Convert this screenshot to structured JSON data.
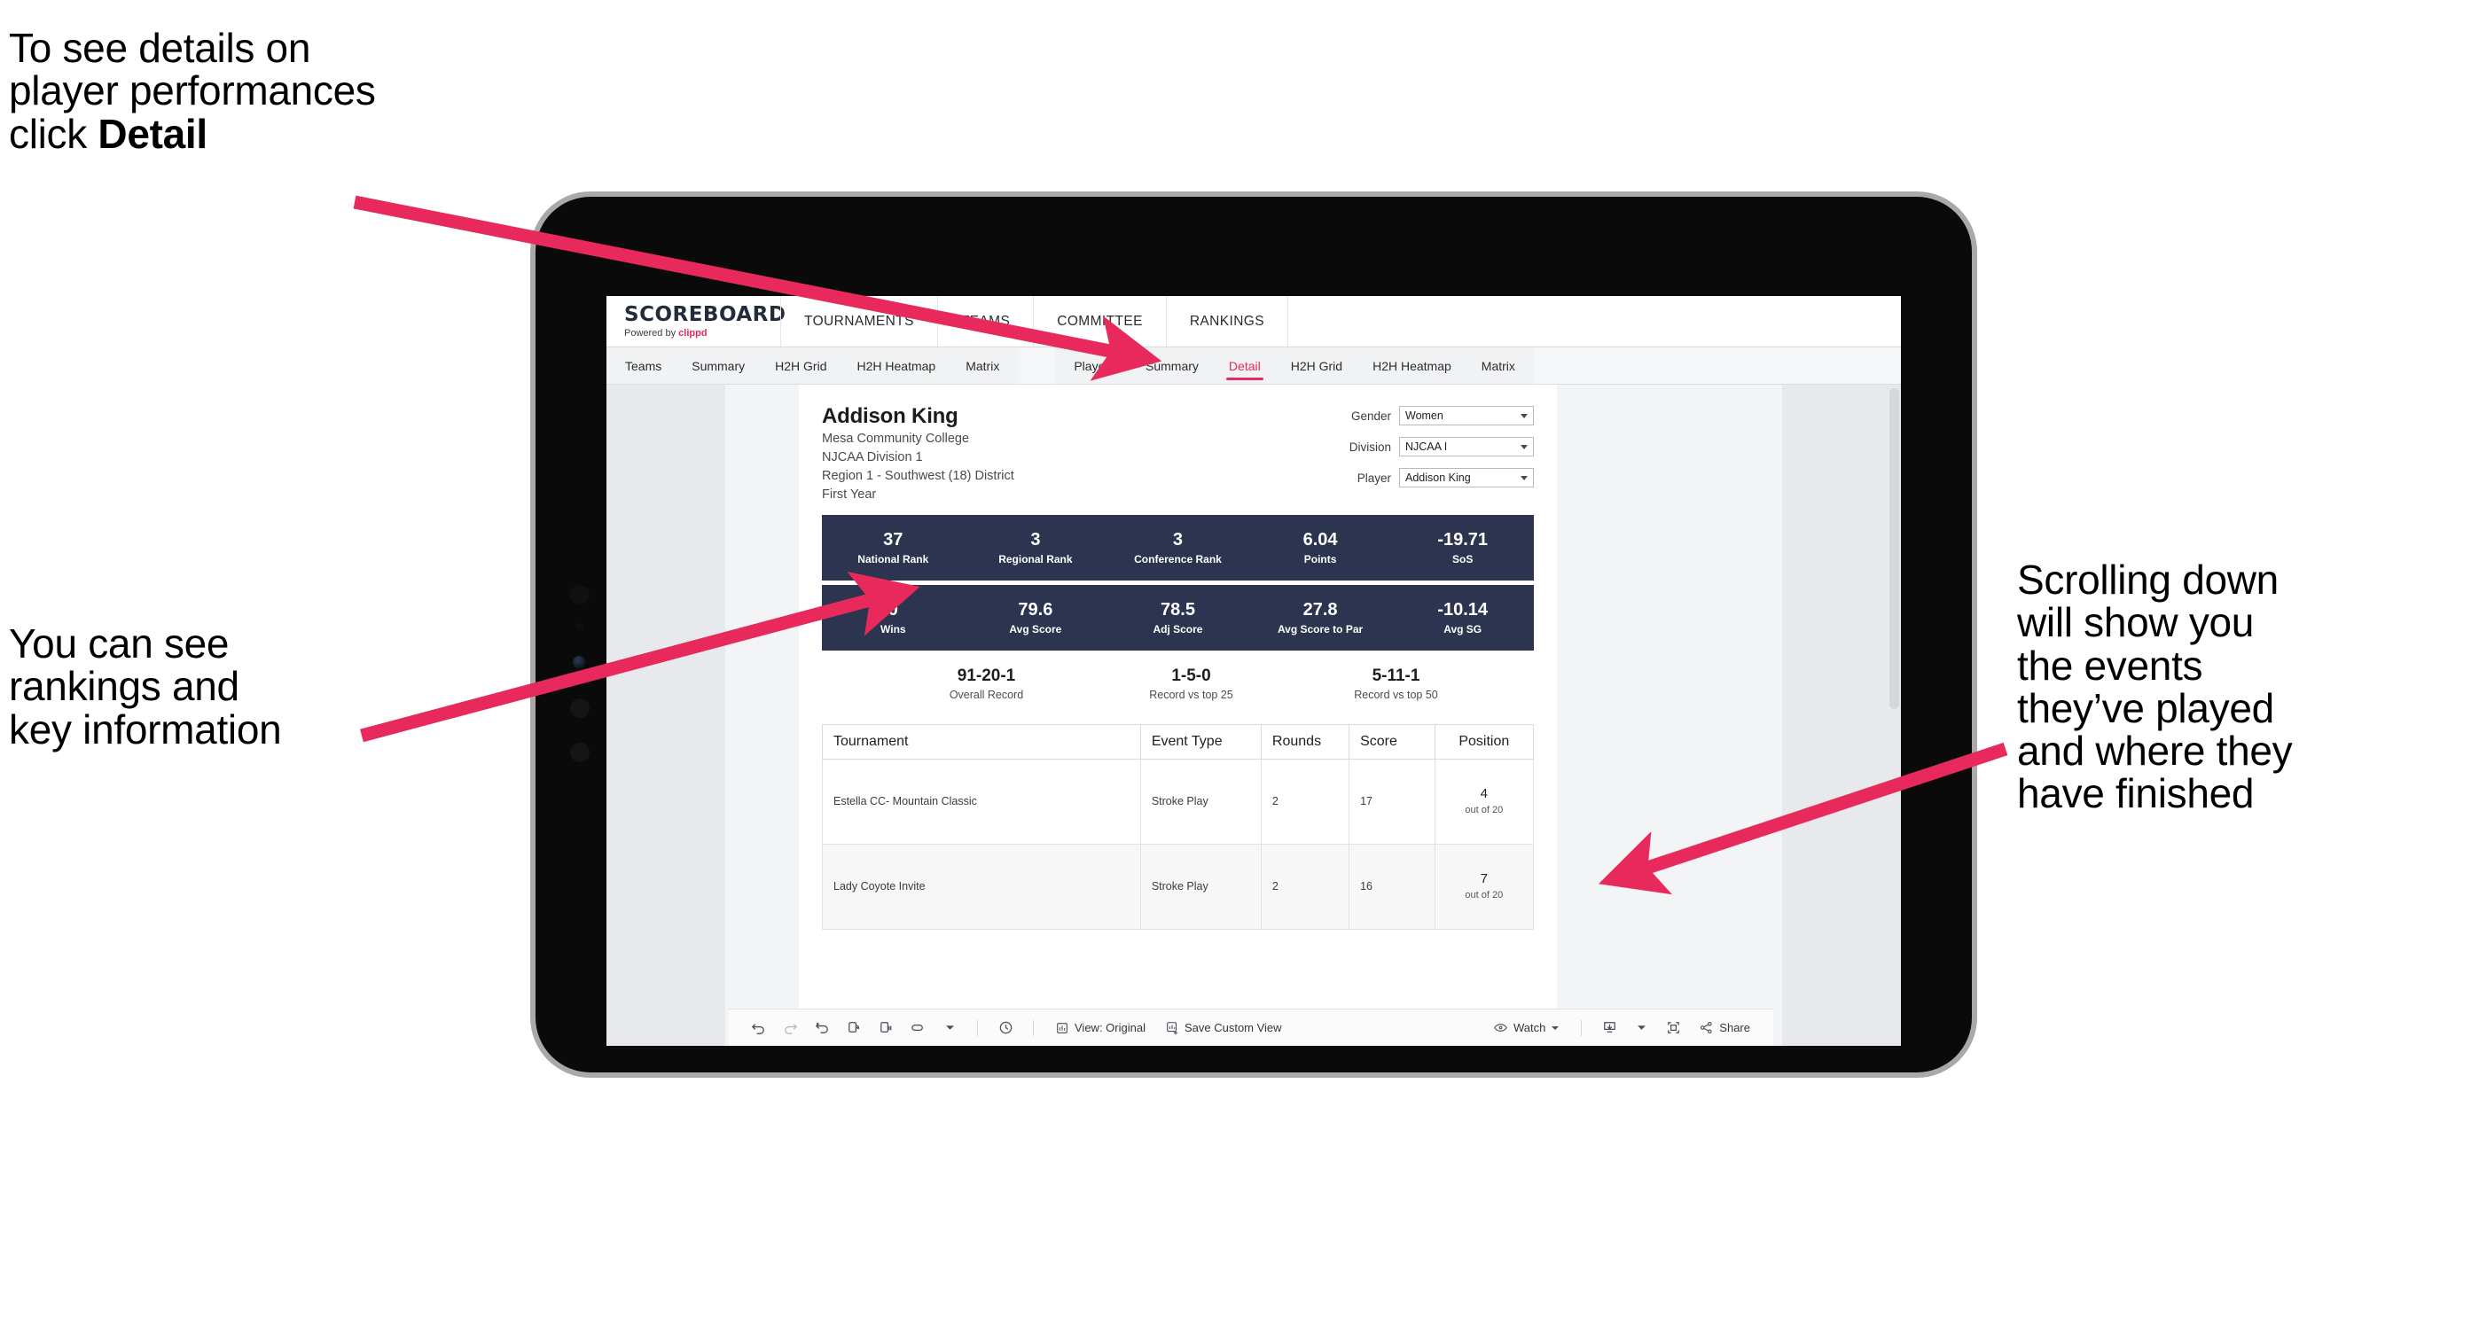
{
  "annotations": {
    "top_left": {
      "line1": "To see details on",
      "line2": "player performances",
      "line3_pre": "click ",
      "line3_bold": "Detail"
    },
    "mid_left": {
      "line1": "You can see",
      "line2": "rankings and",
      "line3": "key information"
    },
    "right": {
      "line1": "Scrolling down",
      "line2": "will show you",
      "line3": "the events",
      "line4": "they’ve played",
      "line5": "and where they",
      "line6": "have finished"
    },
    "arrow_color": "#e8295c"
  },
  "app": {
    "logo": {
      "title": "SCOREBOARD",
      "powered_prefix": "Powered by ",
      "brand": "clippd"
    },
    "top_nav": [
      "TOURNAMENTS",
      "TEAMS",
      "COMMITTEE",
      "RANKINGS"
    ],
    "sub_nav_left": [
      "Teams",
      "Summary",
      "H2H Grid",
      "H2H Heatmap",
      "Matrix"
    ],
    "sub_nav_right": [
      "Players",
      "Summary",
      "Detail",
      "H2H Grid",
      "H2H Heatmap",
      "Matrix"
    ],
    "active_sub_tab": "Detail"
  },
  "player": {
    "name": "Addison King",
    "school": "Mesa Community College",
    "division": "NJCAA Division 1",
    "region": "Region 1 - Southwest (18) District",
    "class_year": "First Year"
  },
  "filters": [
    {
      "label": "Gender",
      "value": "Women"
    },
    {
      "label": "Division",
      "value": "NJCAA I"
    },
    {
      "label": "Player",
      "value": "Addison King"
    }
  ],
  "stats_row_1": [
    {
      "value": "37",
      "label": "National Rank"
    },
    {
      "value": "3",
      "label": "Regional Rank"
    },
    {
      "value": "3",
      "label": "Conference Rank"
    },
    {
      "value": "6.04",
      "label": "Points"
    },
    {
      "value": "-19.71",
      "label": "SoS"
    }
  ],
  "stats_row_2": [
    {
      "value": "0",
      "label": "Wins"
    },
    {
      "value": "79.6",
      "label": "Avg Score"
    },
    {
      "value": "78.5",
      "label": "Adj Score"
    },
    {
      "value": "27.8",
      "label": "Avg Score to Par"
    },
    {
      "value": "-10.14",
      "label": "Avg SG"
    }
  ],
  "records": [
    {
      "value": "91-20-1",
      "label": "Overall Record"
    },
    {
      "value": "1-5-0",
      "label": "Record vs top 25"
    },
    {
      "value": "5-11-1",
      "label": "Record vs top 50"
    }
  ],
  "tournament_table": {
    "headers": [
      "Tournament",
      "Event Type",
      "Rounds",
      "Score",
      "Position"
    ],
    "rows": [
      {
        "tournament": "Estella CC- Mountain Classic",
        "event_type": "Stroke Play",
        "rounds": "2",
        "score": "17",
        "position": "4",
        "position_sub": "out of 20"
      },
      {
        "tournament": "Lady Coyote Invite",
        "event_type": "Stroke Play",
        "rounds": "2",
        "score": "16",
        "position": "7",
        "position_sub": "out of 20"
      }
    ]
  },
  "toolbar": {
    "view_label": "View: Original",
    "save_label": "Save Custom View",
    "watch_label": "Watch",
    "share_label": "Share"
  }
}
